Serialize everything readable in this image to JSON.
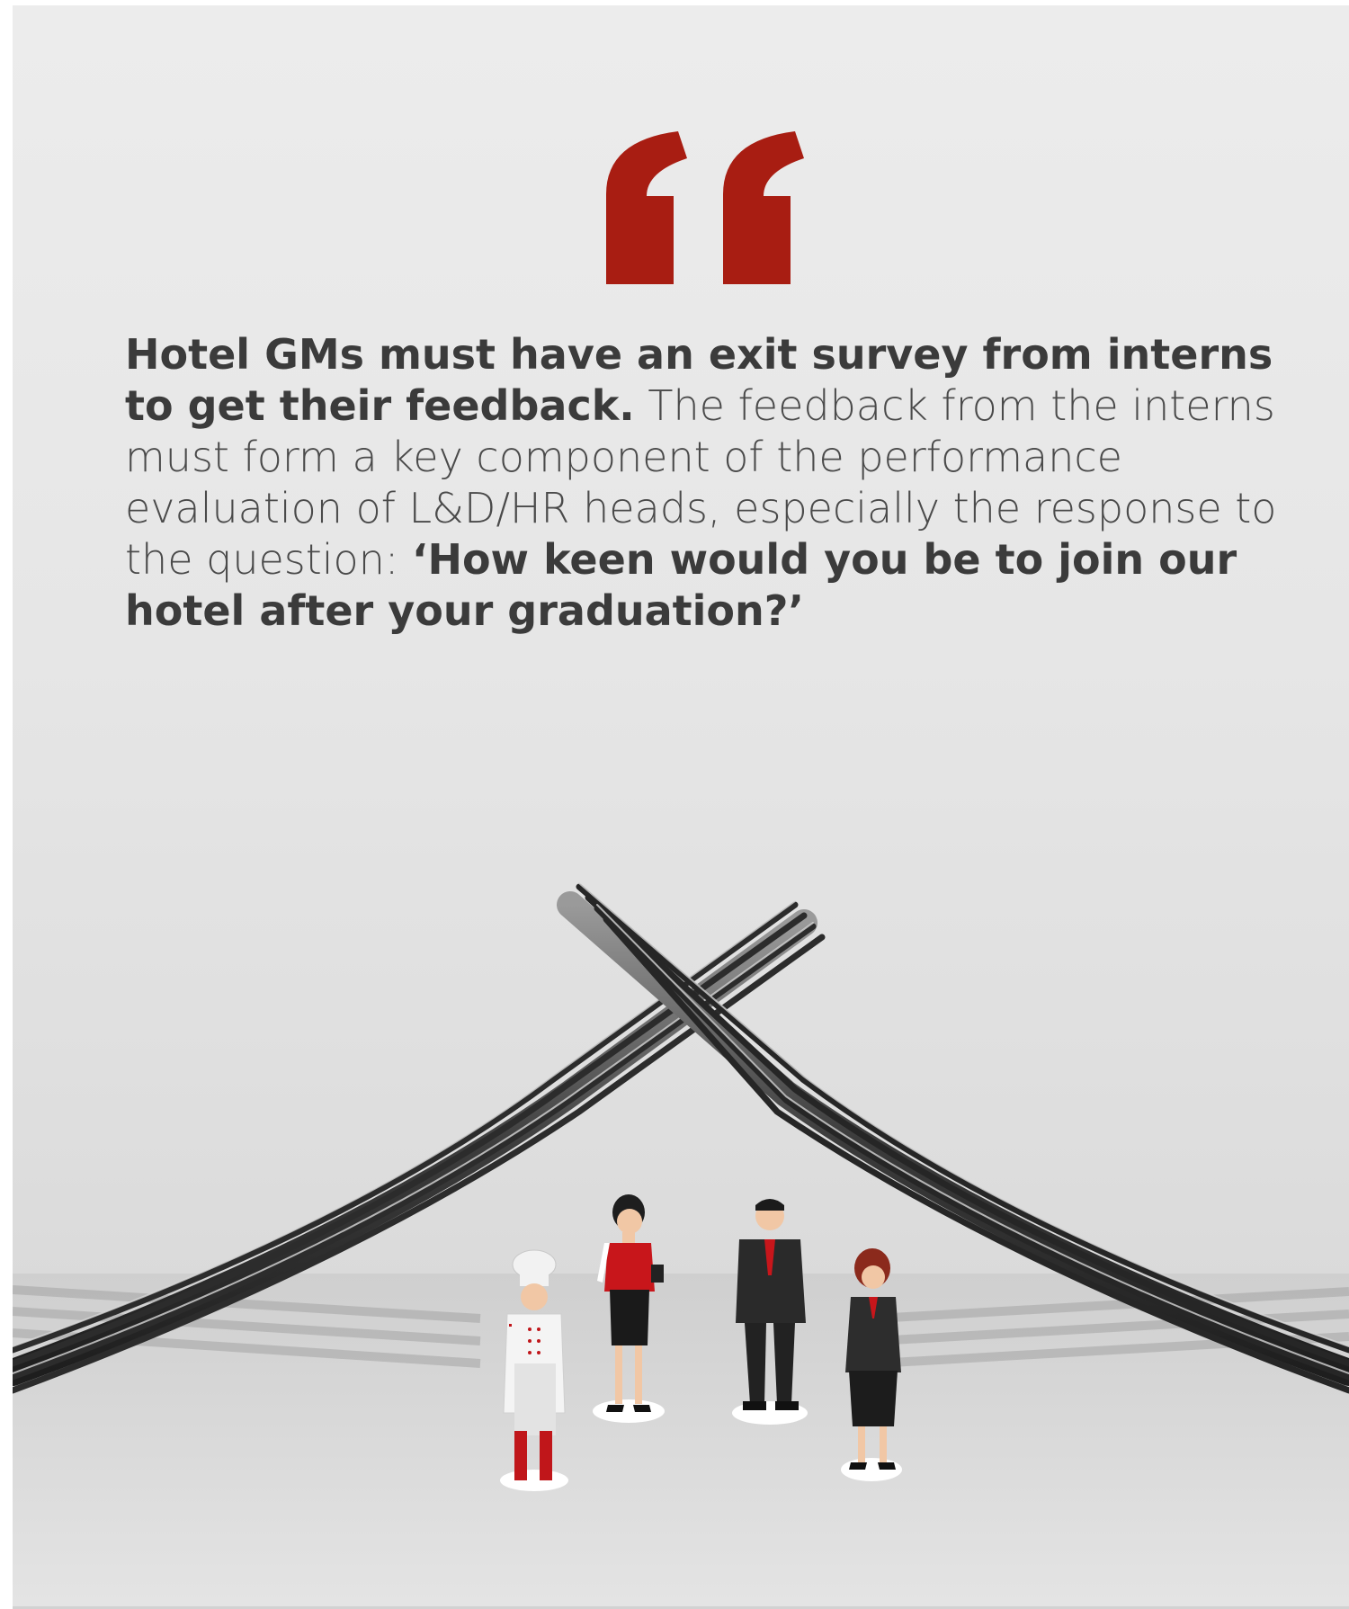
{
  "quote": {
    "lead_bold": "Hotel GMs must have an exit survey from interns to get their feedback.",
    "body": "The feedback from the interns must form a key component of the performance evaluation of L&D/HR heads, especially the response to the question:",
    "question_bold": "‘How keen would you be to join our hotel after your graduation?’",
    "mark_color": "#a81d12"
  },
  "illustration": {
    "subject": "two crossed forks forming a roof over four hotel staff figures",
    "figures": [
      "chef",
      "waitress",
      "manager",
      "receptionist"
    ]
  }
}
